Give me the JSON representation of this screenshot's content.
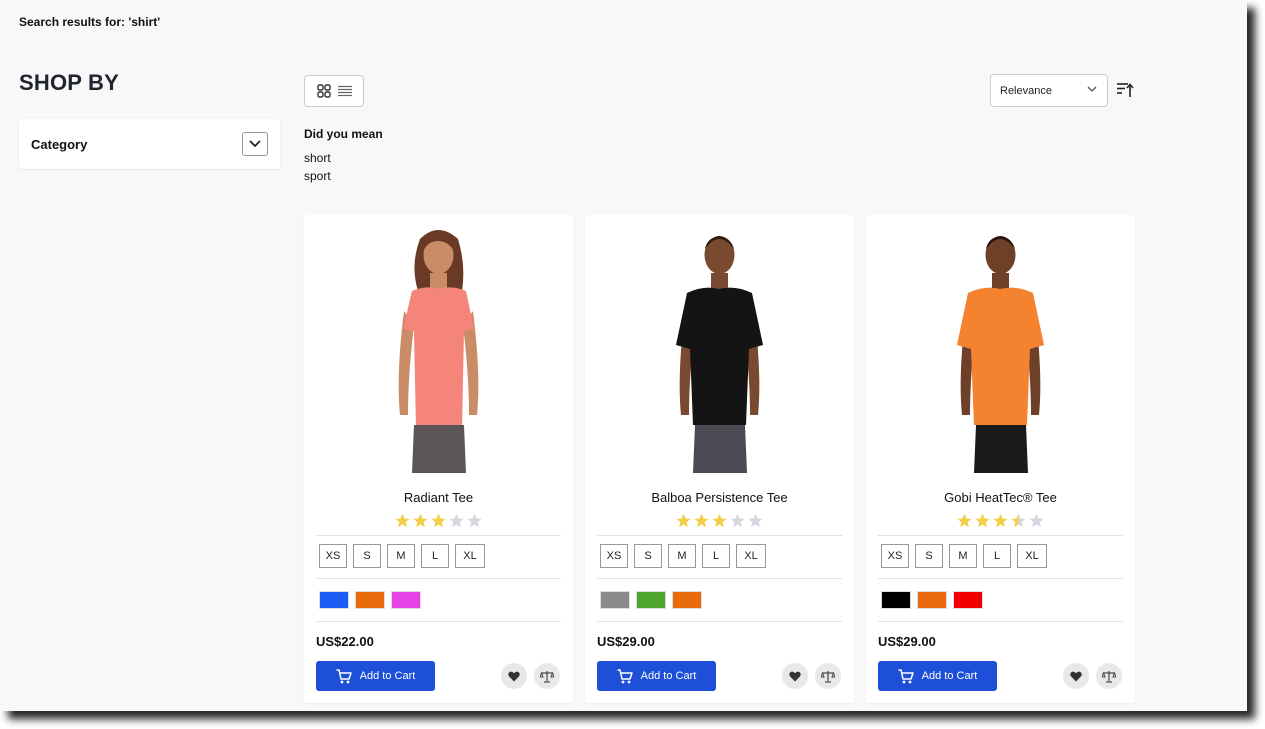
{
  "search": {
    "heading": "Search results for: 'shirt'"
  },
  "sidebar": {
    "title": "SHOP BY",
    "filters": [
      {
        "label": "Category"
      }
    ]
  },
  "toolbar": {
    "view_modes": [
      "grid",
      "list"
    ],
    "sort_by": "Relevance",
    "sort_direction_icon": "sort-ascending-icon"
  },
  "spelling": {
    "title": "Did you mean",
    "suggestions": [
      "short",
      "sport"
    ]
  },
  "products": [
    {
      "name": "Radiant Tee",
      "rating": 3,
      "rating_max": 5,
      "sizes": [
        "XS",
        "S",
        "M",
        "L",
        "XL"
      ],
      "colors": [
        "#1d5cf5",
        "#e86a0a",
        "#e642e8"
      ],
      "price": "US$22.00",
      "add_to_cart": "Add to Cart",
      "shirt_color": "#f5857a",
      "skin_color": "#c98c66",
      "hair_color": "#6b3a26"
    },
    {
      "name": "Balboa Persistence Tee",
      "rating": 3,
      "rating_max": 5,
      "sizes": [
        "XS",
        "S",
        "M",
        "L",
        "XL"
      ],
      "colors": [
        "#8a8a8a",
        "#4ea52d",
        "#e86a0a"
      ],
      "price": "US$29.00",
      "add_to_cart": "Add to Cart",
      "shirt_color": "#141414",
      "skin_color": "#7a4a30",
      "hair_color": "#2a1a12"
    },
    {
      "name": "Gobi HeatTec® Tee",
      "rating": 3.5,
      "rating_max": 5,
      "sizes": [
        "XS",
        "S",
        "M",
        "L",
        "XL"
      ],
      "colors": [
        "#000000",
        "#e86a0a",
        "#f20000"
      ],
      "price": "US$29.00",
      "add_to_cart": "Add to Cart",
      "shirt_color": "#f4822f",
      "skin_color": "#6e4028",
      "hair_color": "#21140d"
    }
  ]
}
